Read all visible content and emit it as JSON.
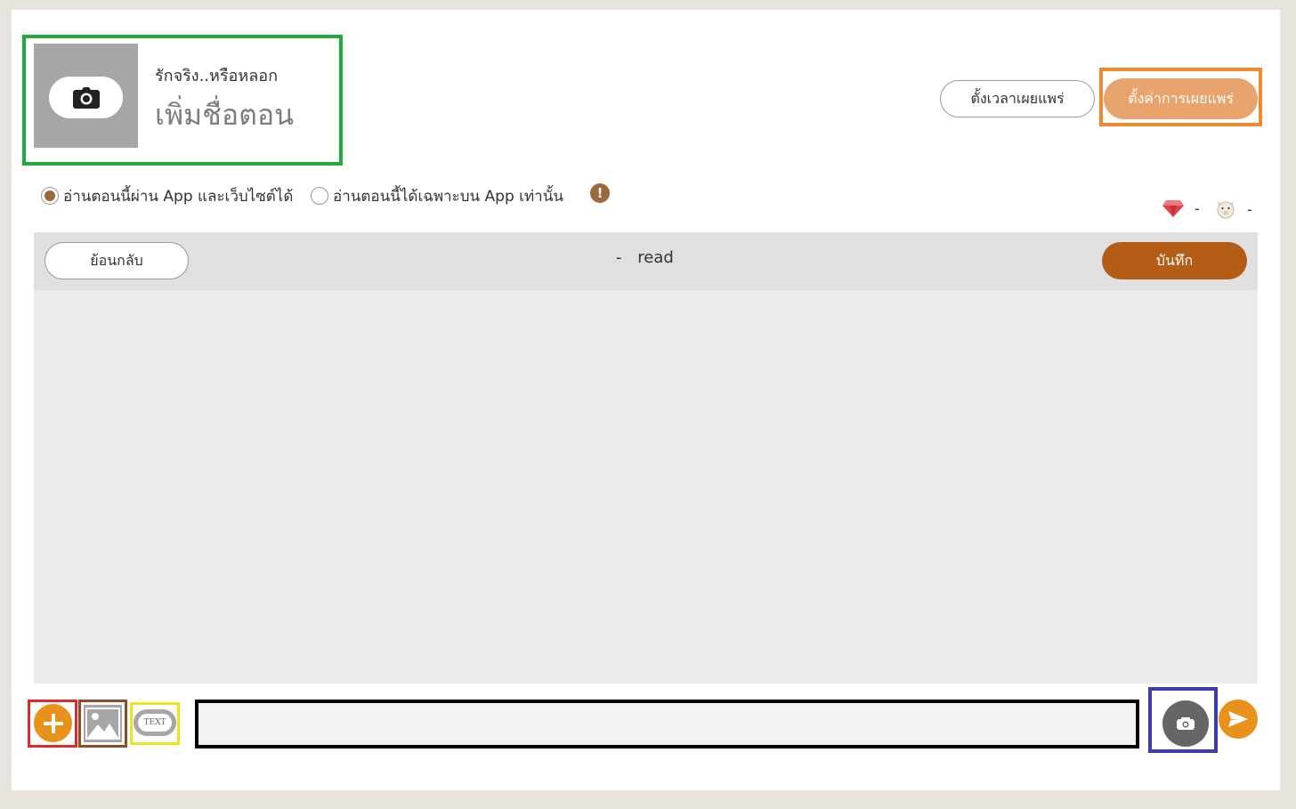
{
  "header": {
    "story_title": "รักจริง..หรือหลอก",
    "episode_title_placeholder": "เพิ่มชื่อตอน"
  },
  "actions": {
    "schedule_label": "ตั้งเวลาเผยแพร่",
    "publish_settings_label": "ตั้งค่าการเผยแพร่"
  },
  "read_options": {
    "items": [
      {
        "label": "อ่านตอนนี้ผ่าน App และเว็บไซต์ได้",
        "selected": true
      },
      {
        "label": "อ่านตอนนี้ได้เฉพาะบน App เท่านั้น",
        "selected": false
      }
    ],
    "info_symbol": "!"
  },
  "stats": {
    "gem_value": "-",
    "mascot_value": "-"
  },
  "editor": {
    "back_label": "ย้อนกลับ",
    "read_count": "-",
    "read_label": "read",
    "save_label": "บันทึก"
  },
  "composer": {
    "text_badge": "TEXT",
    "input_value": ""
  },
  "colors": {
    "accent_orange": "#e8921c",
    "save_brown": "#b35d17",
    "publish_peach": "#e9a36d",
    "radio_brown": "#9a6a3c"
  }
}
